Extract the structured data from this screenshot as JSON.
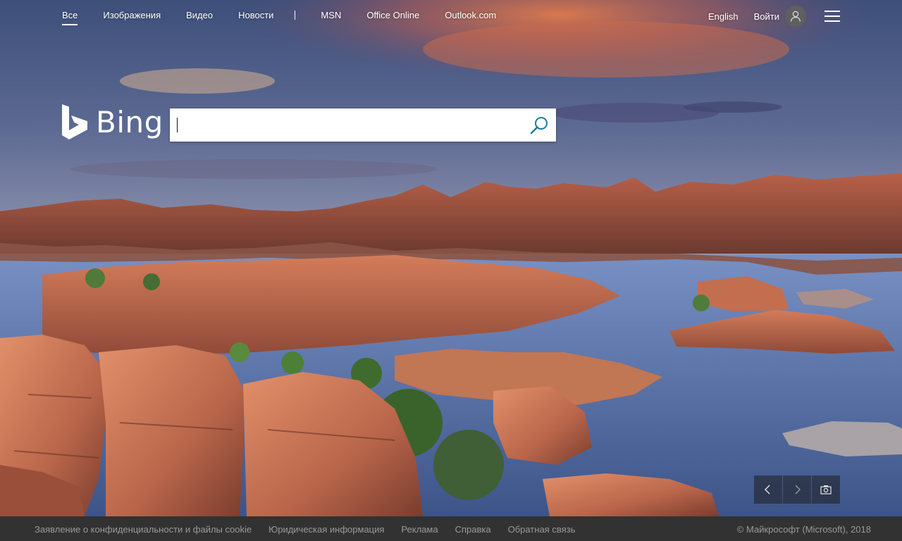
{
  "nav": {
    "items": [
      {
        "label": "Все",
        "active": true
      },
      {
        "label": "Изображения"
      },
      {
        "label": "Видео"
      },
      {
        "label": "Новости"
      }
    ],
    "external": [
      {
        "label": "MSN"
      },
      {
        "label": "Office Online"
      },
      {
        "label": "Outlook.com"
      }
    ],
    "language": "English",
    "signin": "Войти"
  },
  "logo": {
    "text": "Bing"
  },
  "search": {
    "value": "",
    "placeholder": ""
  },
  "image_nav": {
    "prev": "chevron-left-icon",
    "next": "chevron-right-icon",
    "info": "camera-icon"
  },
  "footer": {
    "links": [
      "Заявление о конфиденциальности и файлы cookie",
      "Юридическая информация",
      "Реклама",
      "Справка",
      "Обратная связь"
    ],
    "copyright": "© Майкрософт (Microsoft), 2018"
  },
  "colors": {
    "footer_bg": "#323232",
    "footer_text": "#9a9a9a",
    "search_icon": "#1b7a9d",
    "avatar_bg": "#5f5f5f"
  }
}
